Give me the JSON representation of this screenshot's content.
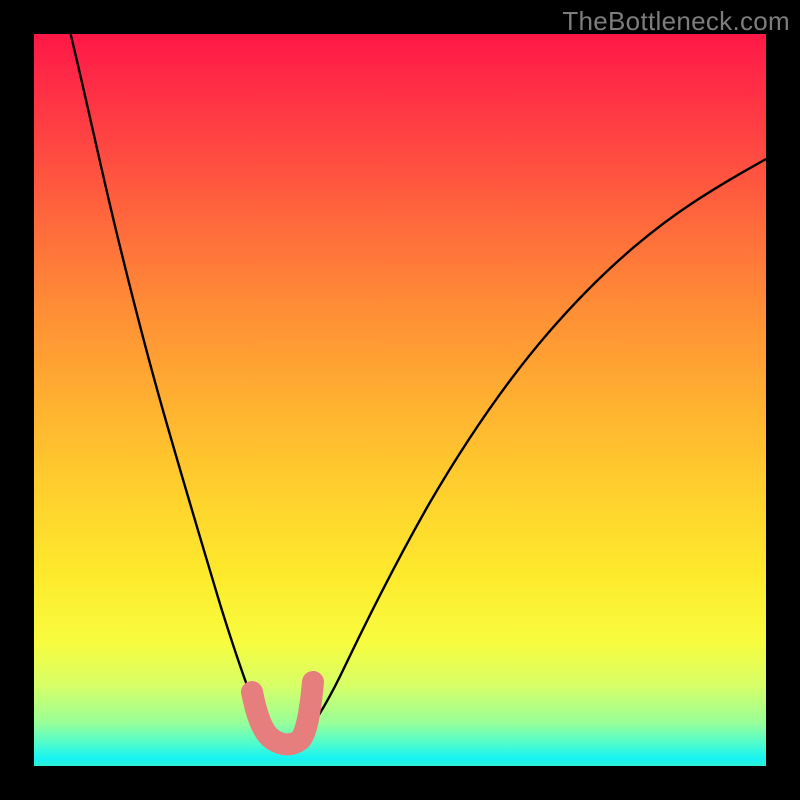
{
  "watermark": "TheBottleneck.com",
  "colors": {
    "curve": "#000000",
    "marker": "#e77e7e",
    "frame": "#000000"
  },
  "chart_data": {
    "type": "line",
    "title": "",
    "xlabel": "",
    "ylabel": "",
    "xlim": [
      0,
      100
    ],
    "ylim": [
      0,
      100
    ],
    "grid": false,
    "series": [
      {
        "name": "bottleneck-curve",
        "x": [
          5,
          8,
          11,
          14,
          17,
          20,
          23,
          26,
          28,
          30,
          31.5,
          33,
          34.5,
          36,
          38,
          41,
          45,
          50,
          56,
          63,
          71,
          80,
          90,
          100
        ],
        "y": [
          100,
          90,
          79,
          68,
          57,
          46,
          35,
          24,
          16,
          10,
          6,
          3.5,
          3,
          3.5,
          6,
          12,
          22,
          34,
          46,
          57,
          66,
          74,
          80,
          85
        ]
      }
    ],
    "marker": {
      "note": "pink U-shaped marker at curve minimum",
      "x_range": [
        30,
        36
      ],
      "y_range": [
        3,
        11
      ]
    },
    "gradient_bands": [
      {
        "pct": 0,
        "color": "#ff1846"
      },
      {
        "pct": 6,
        "color": "#ff2a46"
      },
      {
        "pct": 15,
        "color": "#ff4642"
      },
      {
        "pct": 26,
        "color": "#ff6a3c"
      },
      {
        "pct": 37,
        "color": "#ff8c36"
      },
      {
        "pct": 49,
        "color": "#ffad31"
      },
      {
        "pct": 62,
        "color": "#ffcf2d"
      },
      {
        "pct": 74,
        "color": "#feea2d"
      },
      {
        "pct": 83,
        "color": "#f8fc3e"
      },
      {
        "pct": 89,
        "color": "#d7ff67"
      },
      {
        "pct": 94,
        "color": "#9aff97"
      },
      {
        "pct": 97,
        "color": "#4dfccf"
      },
      {
        "pct": 99,
        "color": "#16f3f3"
      },
      {
        "pct": 100,
        "color": "#2df0d4"
      }
    ]
  }
}
